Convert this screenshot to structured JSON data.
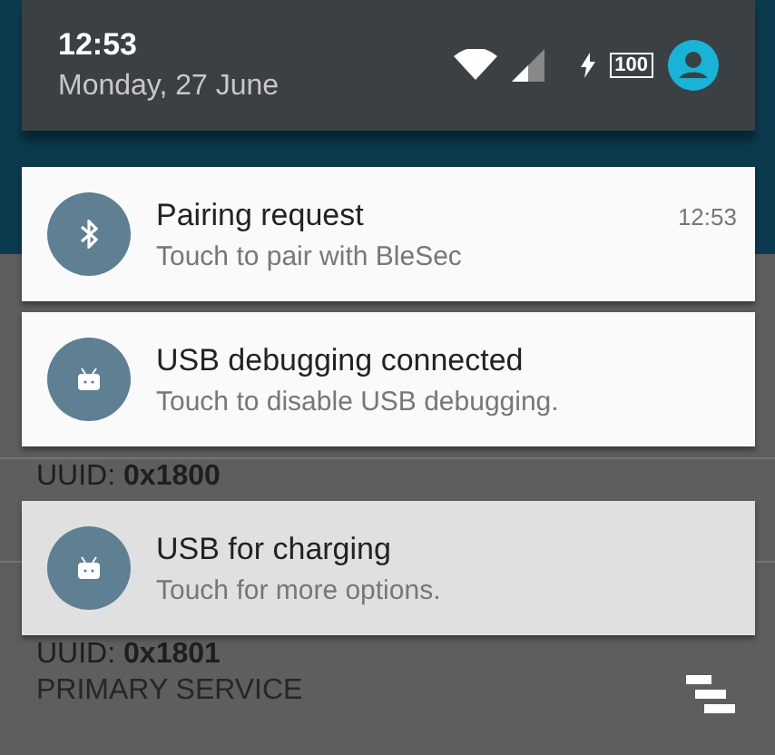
{
  "status_bar": {
    "time": "12:53",
    "date": "Monday, 27 June",
    "battery": "100"
  },
  "notifications": [
    {
      "kind": "bluetooth",
      "title": "Pairing request",
      "text": "Touch to pair with BleSec",
      "time": "12:53",
      "highlighted": false
    },
    {
      "kind": "android",
      "title": "USB debugging connected",
      "text": "Touch to disable USB debugging.",
      "highlighted": false
    },
    {
      "kind": "android",
      "title": "USB for charging",
      "text": "Touch for more options.",
      "highlighted": true
    }
  ],
  "background_list": [
    {
      "uuid_label": "UUID:",
      "uuid": "0x1800"
    },
    {
      "uuid_label": "UUID:",
      "uuid": "0x1801",
      "type": "PRIMARY SERVICE"
    }
  ]
}
